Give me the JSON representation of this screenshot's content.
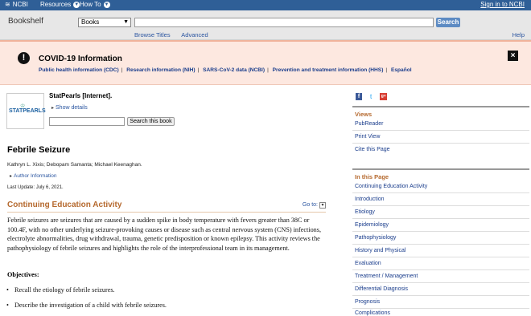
{
  "topbar": {
    "ncbi_label": "NCBI",
    "resources_label": "Resources",
    "howto_label": "How To",
    "signin_label": "Sign in to NCBI"
  },
  "header": {
    "title": "Bookshelf",
    "db_select": "Books",
    "search_value": "",
    "search_button": "Search",
    "browse_titles": "Browse Titles",
    "advanced": "Advanced",
    "help": "Help"
  },
  "covid": {
    "title": "COVID-19 Information",
    "links": [
      "Public health information (CDC)",
      "Research information (NIH)",
      "SARS-CoV-2 data (NCBI)",
      "Prevention and treatment information (HHS)",
      "Español"
    ],
    "close": "×",
    "icon": "!"
  },
  "book": {
    "cover_logo": "STATPEARLS",
    "title": "StatPearls [Internet].",
    "show_details": "Show details",
    "search_value": "",
    "search_button": "Search this book"
  },
  "article": {
    "title": "Febrile Seizure",
    "authors": "Kathryn L. Xixis; Debopam Samanta; Michael Keenaghan.",
    "author_info": "Author Information",
    "last_update": "Last Update: July 6, 2021."
  },
  "section": {
    "title": "Continuing Education Activity",
    "goto": "Go to:",
    "body": "Febrile seizures are seizures that are caused by a sudden spike in body temperature with fevers greater than 38C or 100.4F, with no other underlying seizure-provoking causes or disease such as central nervous system (CNS) infections, electrolyte abnormalities, drug withdrawal, trauma, genetic predisposition or known epilepsy. This activity reviews the pathophysiology of febrile seizures and highlights the role of the interprofessional team in its management.",
    "objectives_label": "Objectives:",
    "objectives": [
      "Recall the etiology of febrile seizures.",
      "Describe the investigation of a child with febrile seizures."
    ]
  },
  "sidebar": {
    "share_icons": [
      "facebook-icon",
      "twitter-icon",
      "google-plus-icon"
    ],
    "share_labels": [
      "f",
      "t",
      "g+"
    ],
    "views_title": "Views",
    "views": [
      "PubReader",
      "Print View",
      "Cite this Page"
    ],
    "toc_title": "In this Page",
    "toc": [
      "Continuing Education Activity",
      "Introduction",
      "Etiology",
      "Epidemiology",
      "Pathophysiology",
      "History and Physical",
      "Evaluation",
      "Treatment / Management",
      "Differential Diagnosis",
      "Prognosis",
      "Complications"
    ]
  }
}
